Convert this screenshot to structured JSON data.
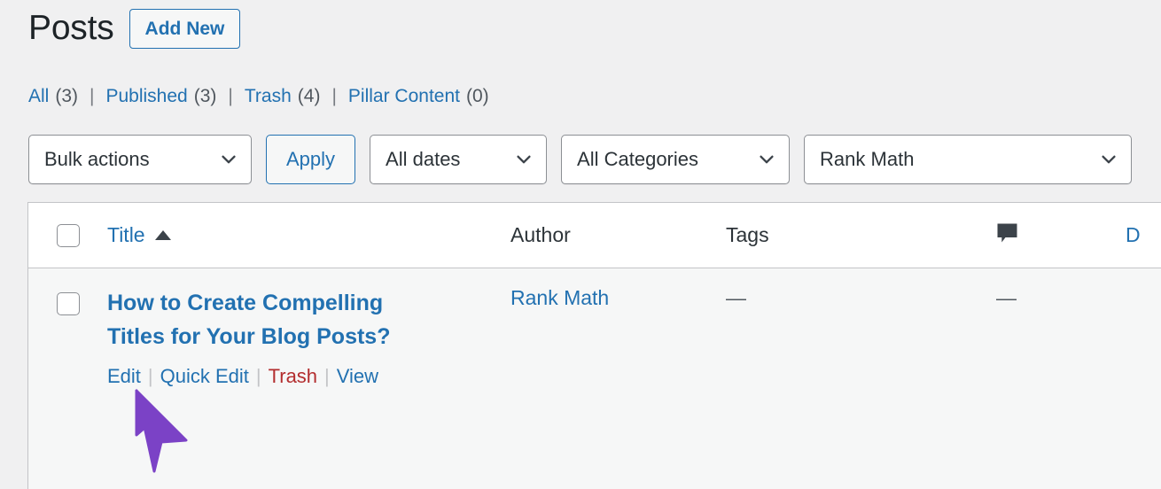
{
  "header": {
    "title": "Posts",
    "add_new_label": "Add New"
  },
  "status_links": [
    {
      "label": "All",
      "count": "(3)"
    },
    {
      "label": "Published",
      "count": "(3)"
    },
    {
      "label": "Trash",
      "count": "(4)"
    },
    {
      "label": "Pillar Content",
      "count": "(0)"
    }
  ],
  "separator": "|",
  "tablenav": {
    "bulk_actions": "Bulk actions",
    "apply_label": "Apply",
    "all_dates": "All dates",
    "all_categories": "All Categories",
    "rank_math": "Rank Math"
  },
  "table": {
    "columns": {
      "title": "Title",
      "author": "Author",
      "tags": "Tags",
      "comments_icon": "comment-bubble-icon",
      "date": "D"
    },
    "sort": "ascending",
    "rows": [
      {
        "title": "How to Create Compelling Titles for Your Blog Posts?",
        "actions": {
          "edit": "Edit",
          "quick_edit": "Quick Edit",
          "trash": "Trash",
          "view": "View"
        },
        "action_separator": "|",
        "author": "Rank Math",
        "tags": "—",
        "comments": "—"
      }
    ]
  },
  "cursor": {
    "type": "arrow-pointer",
    "color": "#7b42c6"
  },
  "colors": {
    "page_background": "#f0f0f1",
    "link": "#2271b1",
    "trash_link": "#b32d2e",
    "row_background": "#f6f7f7",
    "border": "#c3c4c7"
  }
}
